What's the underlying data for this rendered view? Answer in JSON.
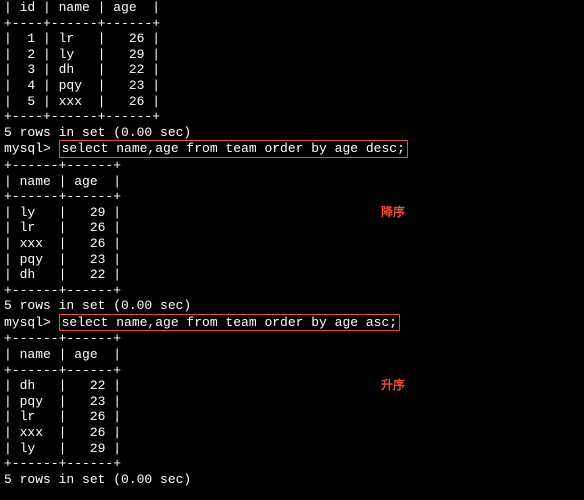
{
  "table1": {
    "border_top": "| id | name | age  |",
    "border_sep": "+----+------+------+",
    "rows": [
      "|  1 | lr   |   26 |",
      "|  2 | ly   |   29 |",
      "|  3 | dh   |   22 |",
      "|  4 | pqy  |   23 |",
      "|  5 | xxx  |   26 |"
    ],
    "footer": "5 rows in set (0.00 sec)"
  },
  "prompt": "mysql> ",
  "query_desc": "select name,age from team order by age desc;",
  "table2": {
    "header": "| name | age  |",
    "sep": "+------+------+",
    "rows": [
      "| ly   |   29 |",
      "| lr   |   26 |",
      "| xxx  |   26 |",
      "| pqy  |   23 |",
      "| dh   |   22 |"
    ],
    "footer": "5 rows in set (0.00 sec)"
  },
  "annotation_desc": "降序",
  "query_asc": "select name,age from team order by age asc;",
  "table3": {
    "header": "| name | age  |",
    "sep": "+------+------+",
    "rows": [
      "| dh   |   22 |",
      "| pqy  |   23 |",
      "| lr   |   26 |",
      "| xxx  |   26 |",
      "| ly   |   29 |"
    ],
    "footer": "5 rows in set (0.00 sec)"
  },
  "annotation_asc": "升序",
  "blank": ""
}
